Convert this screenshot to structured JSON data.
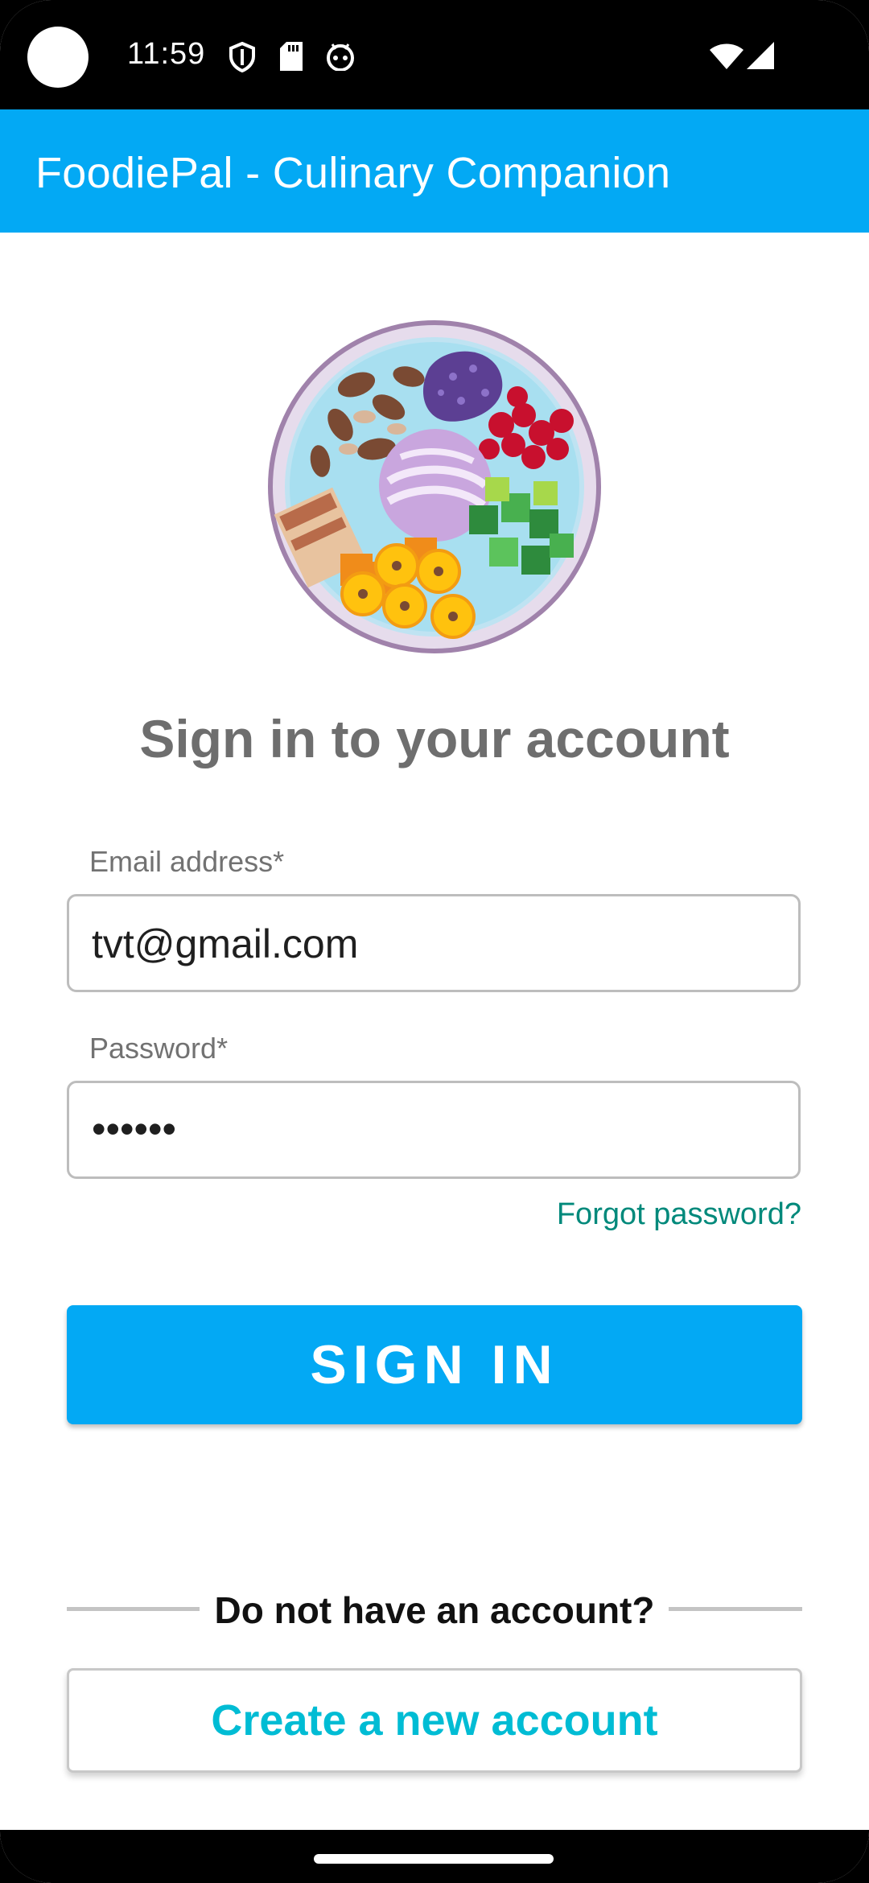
{
  "status_bar": {
    "time": "11:59",
    "icons": [
      "shield-icon",
      "sd-card-icon",
      "android-debug-icon",
      "wifi-icon",
      "cellular-signal-icon"
    ]
  },
  "app_bar": {
    "title": "FoodiePal - Culinary Companion",
    "color": "#03a9f4"
  },
  "logo": {
    "icon": "food-bowl-icon"
  },
  "heading": "Sign in to your account",
  "form": {
    "email_label": "Email address*",
    "email_value": "tvt@gmail.com",
    "password_label": "Password*",
    "password_value": "••••••",
    "forgot_link": "Forgot password?"
  },
  "sign_in_button": "SIGN IN",
  "signup": {
    "prompt": "Do not have an account?",
    "create_button": "Create a new account"
  },
  "colors": {
    "primary": "#03a9f4",
    "link": "#00897b",
    "create_text": "#00bcd4"
  }
}
